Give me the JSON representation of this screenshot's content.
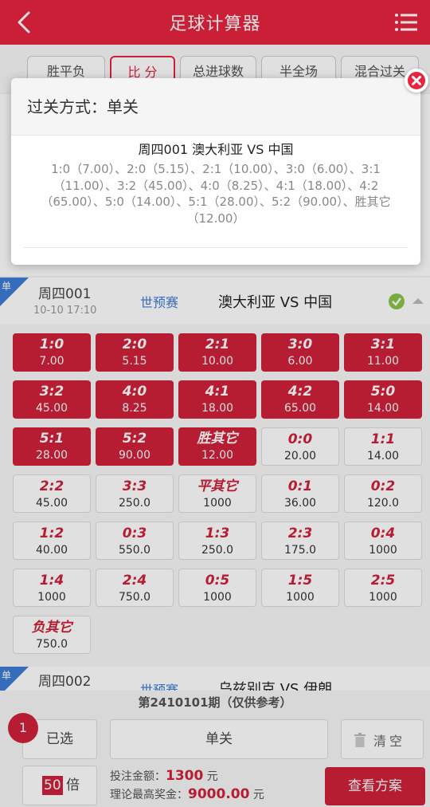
{
  "header": {
    "title": "足球计算器",
    "back_icon": "chevron-left-icon",
    "menu_icon": "list-menu-icon"
  },
  "tabs": [
    {
      "label": "胜平负"
    },
    {
      "label": "比 分"
    },
    {
      "label": "总进球数"
    },
    {
      "label": "半全场"
    },
    {
      "label": "混合过关"
    }
  ],
  "match1": {
    "flag": "单",
    "no": "周四001",
    "time": "10-10 17:10",
    "league": "世预赛",
    "teams": "澳大利亚  VS  中国"
  },
  "scores": [
    {
      "score": "1:0",
      "odds": "7.00",
      "selected": true
    },
    {
      "score": "2:0",
      "odds": "5.15",
      "selected": true
    },
    {
      "score": "2:1",
      "odds": "10.00",
      "selected": true
    },
    {
      "score": "3:0",
      "odds": "6.00",
      "selected": true
    },
    {
      "score": "3:1",
      "odds": "11.00",
      "selected": true
    },
    {
      "score": "3:2",
      "odds": "45.00",
      "selected": true
    },
    {
      "score": "4:0",
      "odds": "8.25",
      "selected": true
    },
    {
      "score": "4:1",
      "odds": "18.00",
      "selected": true
    },
    {
      "score": "4:2",
      "odds": "65.00",
      "selected": true
    },
    {
      "score": "5:0",
      "odds": "14.00",
      "selected": true
    },
    {
      "score": "5:1",
      "odds": "28.00",
      "selected": true
    },
    {
      "score": "5:2",
      "odds": "90.00",
      "selected": true
    },
    {
      "score": "胜其它",
      "odds": "12.00",
      "selected": true
    },
    {
      "score": "0:0",
      "odds": "20.00",
      "selected": false
    },
    {
      "score": "1:1",
      "odds": "14.00",
      "selected": false
    },
    {
      "score": "2:2",
      "odds": "45.00",
      "selected": false
    },
    {
      "score": "3:3",
      "odds": "250.0",
      "selected": false
    },
    {
      "score": "平其它",
      "odds": "1000",
      "selected": false
    },
    {
      "score": "0:1",
      "odds": "36.00",
      "selected": false
    },
    {
      "score": "0:2",
      "odds": "120.0",
      "selected": false
    },
    {
      "score": "1:2",
      "odds": "40.00",
      "selected": false
    },
    {
      "score": "0:3",
      "odds": "550.0",
      "selected": false
    },
    {
      "score": "1:3",
      "odds": "250.0",
      "selected": false
    },
    {
      "score": "2:3",
      "odds": "175.0",
      "selected": false
    },
    {
      "score": "0:4",
      "odds": "1000",
      "selected": false
    },
    {
      "score": "1:4",
      "odds": "1000",
      "selected": false
    },
    {
      "score": "2:4",
      "odds": "750.0",
      "selected": false
    },
    {
      "score": "0:5",
      "odds": "1000",
      "selected": false
    },
    {
      "score": "1:5",
      "odds": "1000",
      "selected": false
    },
    {
      "score": "2:5",
      "odds": "1000",
      "selected": false
    },
    {
      "score": "负其它",
      "odds": "750.0",
      "selected": false
    }
  ],
  "match2": {
    "flag": "单",
    "no": "周四002",
    "league": "世预赛",
    "teams": "乌兹别克  VS  伊朗"
  },
  "bottom": {
    "period": "第2410101期（仅供参考）",
    "selected_label": "已选",
    "badge_count": "1",
    "mode_label": "单关",
    "clear_label": "清空",
    "multiple": "50",
    "multiple_unit": "倍",
    "bet_label": "投注金额：",
    "bet_amount": "1300",
    "bet_unit": "元",
    "max_label": "理论最高奖金：",
    "max_amount": "9000.00",
    "max_unit": "元",
    "plan_label": "查看方案"
  },
  "modal": {
    "title": "过关方式：单关",
    "match": "周四001 澳大利亚 VS 中国",
    "detail": "1:0（7.00）、2:0（5.15）、2:1（10.00）、3:0（6.00）、3:1（11.00）、3:2（45.00）、4:0（8.25）、4:1（18.00）、4:2（65.00）、5:0（14.00）、5:1（28.00）、5:2（90.00）、胜其它（12.00）",
    "close_icon": "close-icon"
  },
  "colors": {
    "brand_red": "#e8243f",
    "cell_red": "#d0213a",
    "league_blue": "#3d7bd6",
    "check_green": "#8bc34a"
  }
}
